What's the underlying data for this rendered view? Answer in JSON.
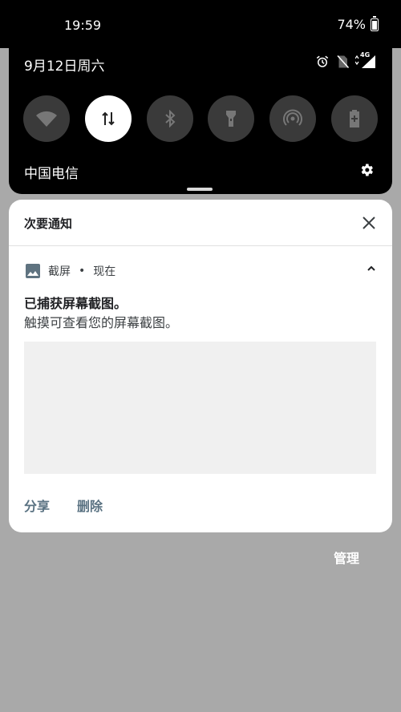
{
  "status_bar": {
    "time": "19:59",
    "battery_percent": "74%",
    "battery_level": 0.74
  },
  "quick_settings": {
    "date": "9月12日周六",
    "carrier": "中国电信",
    "network_label": "4G",
    "tiles": [
      {
        "icon": "wifi-icon",
        "active": false
      },
      {
        "icon": "mobile-data-icon",
        "active": true
      },
      {
        "icon": "bluetooth-icon",
        "active": false
      },
      {
        "icon": "flashlight-icon",
        "active": false
      },
      {
        "icon": "hotspot-icon",
        "active": false
      },
      {
        "icon": "battery-saver-icon",
        "active": false
      }
    ]
  },
  "notification": {
    "section_title": "次要通知",
    "app_name": "截屏",
    "separator": "•",
    "time": "现在",
    "title": "已捕获屏幕截图。",
    "text": "触摸可查看您的屏幕截图。",
    "actions": {
      "share": "分享",
      "delete": "删除"
    }
  },
  "manage_label": "管理"
}
